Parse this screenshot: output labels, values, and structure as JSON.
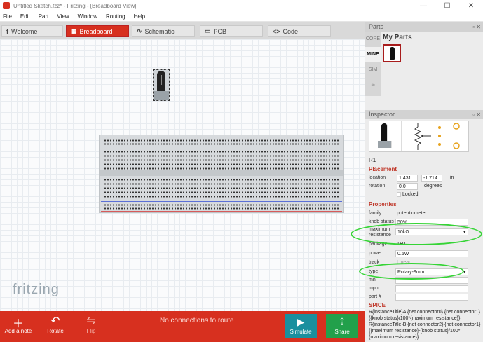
{
  "window": {
    "title": "Untitled Sketch.fzz* - Fritzing - [Breadboard View]",
    "minimize": "—",
    "maximize": "☐",
    "close": "✕"
  },
  "menu": [
    "File",
    "Edit",
    "Part",
    "View",
    "Window",
    "Routing",
    "Help"
  ],
  "tabs": [
    {
      "label": "Welcome",
      "icon": "f"
    },
    {
      "label": "Breadboard",
      "icon": "▦"
    },
    {
      "label": "Schematic",
      "icon": "∿"
    },
    {
      "label": "PCB",
      "icon": "▭"
    },
    {
      "label": "Code",
      "icon": "<>"
    }
  ],
  "canvas": {
    "logo": "fritzing"
  },
  "bottombar": {
    "add_note": "Add a note",
    "rotate": "Rotate",
    "flip": "Flip",
    "status": "No connections to route",
    "simulate": "Simulate",
    "share": "Share"
  },
  "parts": {
    "header": "Parts",
    "title": "My Parts",
    "side_tabs": [
      "CORE",
      "MINE",
      "SIM",
      "∞"
    ]
  },
  "inspector": {
    "header": "Inspector",
    "part_id": "R1",
    "placement_title": "Placement",
    "location_label": "location",
    "location_x": "1.431",
    "location_y": "-1.714",
    "location_unit": "in",
    "rotation_label": "rotation",
    "rotation_value": "0.0",
    "rotation_unit": "degrees",
    "locked_label": "Locked",
    "properties_title": "Properties",
    "props": {
      "family_label": "family",
      "family": "potentiometer",
      "knob_label": "knob status",
      "knob": "50%",
      "maxres_label": "maximum resistance",
      "maxres": "10kΩ",
      "package_label": "package",
      "package": "THT",
      "power_label": "power",
      "power": "0.5W",
      "track_label": "track",
      "track": "Linear",
      "type_label": "type",
      "type": "Rotary-9mm",
      "mn_label": "mn",
      "mpn_label": "mpn",
      "partno_label": "part #"
    },
    "spice_title": "SPICE",
    "spice_text": "R{instanceTitle}A {net connector0} {net connector1} {{knob status}/100*{maximum resistance}} R{instanceTitle}B {net connector2} {net connector1} {{maximum resistance}-{knob status}/100*{maximum resistance}}"
  },
  "colors": {
    "accent": "#d7301f",
    "simulate": "#1a8f9e",
    "share": "#22a04b",
    "annotation": "#35d435"
  }
}
